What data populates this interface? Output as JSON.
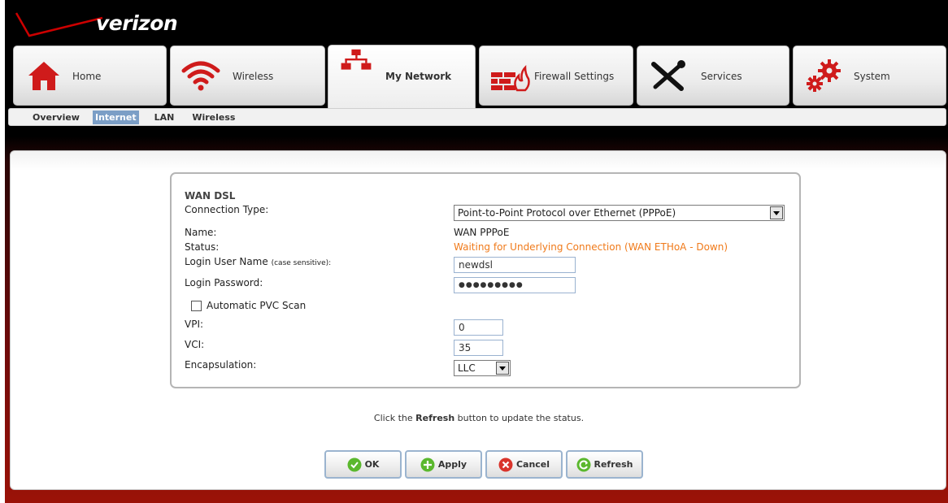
{
  "brand": {
    "logo_text": "verizon",
    "accent": "#cc0000",
    "icon_color": "#cf1b1b"
  },
  "tabs": [
    {
      "id": "home",
      "label": "Home",
      "icon": "house-icon"
    },
    {
      "id": "wireless",
      "label": "Wireless",
      "icon": "wifi-icon"
    },
    {
      "id": "my_network",
      "label": "My Network",
      "icon": "network-icon",
      "active": true
    },
    {
      "id": "firewall",
      "label": "Firewall Settings",
      "icon": "firewall-icon"
    },
    {
      "id": "services",
      "label": "Services",
      "icon": "tools-icon"
    },
    {
      "id": "system",
      "label": "System",
      "icon": "gears-icon"
    }
  ],
  "subnav": [
    {
      "label": "Overview"
    },
    {
      "label": "Internet",
      "active": true
    },
    {
      "label": "LAN"
    },
    {
      "label": "Wireless"
    }
  ],
  "form": {
    "section_title": "WAN DSL",
    "connection_type_label": "Connection Type:",
    "connection_type_value": "Point-to-Point Protocol over Ethernet (PPPoE)",
    "name_label": "Name:",
    "name_value": "WAN PPPoE",
    "status_label": "Status:",
    "status_value": "Waiting for Underlying Connection (WAN ETHoA - Down)",
    "login_user_label": "Login User Name",
    "login_user_note": "(case sensitive):",
    "login_user_value": "newdsl",
    "login_password_label": "Login Password:",
    "login_password_value": "●●●●●●●●●",
    "auto_pvc_label": "Automatic PVC Scan",
    "auto_pvc_checked": false,
    "vpi_label": "VPI:",
    "vpi_value": "0",
    "vci_label": "VCI:",
    "vci_value": "35",
    "encapsulation_label": "Encapsulation:",
    "encapsulation_value": "LLC"
  },
  "hint": {
    "before": "Click the ",
    "bold": "Refresh",
    "after": " button to update the status."
  },
  "buttons": {
    "ok": "OK",
    "apply": "Apply",
    "cancel": "Cancel",
    "refresh": "Refresh"
  },
  "colors": {
    "status_orange": "#f07a1a",
    "button_green": "#5bb82e",
    "button_red": "#d9342b",
    "subnav_active": "#7b9ec6"
  }
}
